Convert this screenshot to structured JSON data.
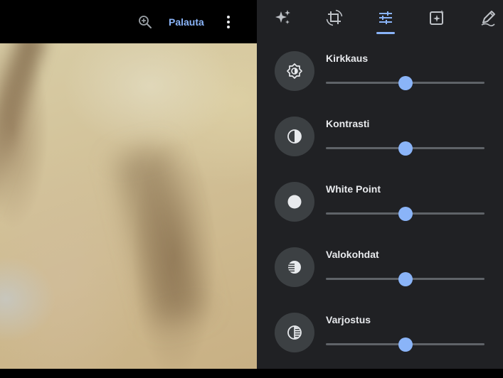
{
  "toolbar": {
    "zoom_icon": "zoom-in-icon",
    "revert_label": "Palauta",
    "more_icon": "more-vert-icon"
  },
  "tabs": [
    {
      "id": "suggestions",
      "icon": "sparkle-icon",
      "selected": false
    },
    {
      "id": "crop-rotate",
      "icon": "crop-rotate-icon",
      "selected": false
    },
    {
      "id": "adjust",
      "icon": "tune-icon",
      "selected": true
    },
    {
      "id": "filters",
      "icon": "filter-sparkle-icon",
      "selected": false
    },
    {
      "id": "markup",
      "icon": "markup-pen-icon",
      "selected": false
    }
  ],
  "adjustments": [
    {
      "label": "Kirkkaus",
      "icon": "brightness-icon",
      "level": 0.5
    },
    {
      "label": "Kontrasti",
      "icon": "contrast-icon",
      "level": 0.5
    },
    {
      "label": "White Point",
      "icon": "white-point-icon",
      "level": 0.5
    },
    {
      "label": "Valokohdat",
      "icon": "highlights-icon",
      "level": 0.5
    },
    {
      "label": "Varjostus",
      "icon": "shadows-icon",
      "level": 0.5
    }
  ],
  "colors": {
    "accent": "#8ab4f8",
    "panel_bg": "#202124",
    "icon_circle": "#3c4043",
    "track": "#5f6368",
    "text": "#e8eaed"
  }
}
